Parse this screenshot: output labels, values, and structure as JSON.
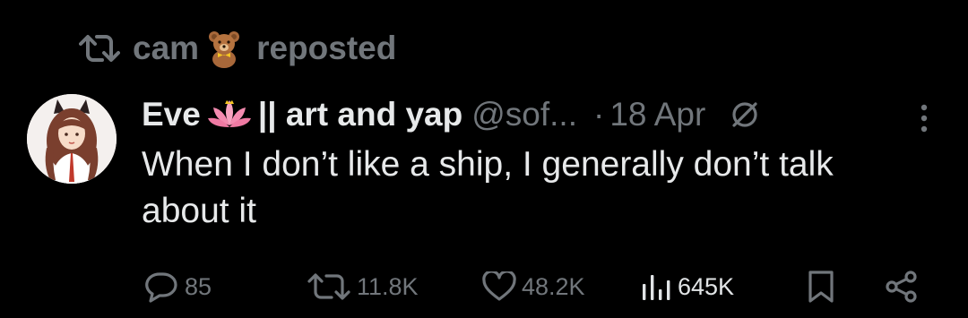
{
  "repost_banner": {
    "user": "cam",
    "user_emoji": "teddy-bear-emoji",
    "label": "reposted"
  },
  "tweet": {
    "author_name": "Eve",
    "author_emoji": "lotus-emoji",
    "author_suffix": "|| art and yap",
    "handle": "@sof...",
    "separator": "·",
    "date": "18 Apr",
    "text": "When I don’t like a ship, I generally don’t talk about it"
  },
  "actions": {
    "replies": "85",
    "reposts": "11.8K",
    "likes": "48.2K",
    "views": "645K"
  },
  "colors": {
    "background": "#000000",
    "primary_text": "#e7e9ea",
    "secondary_text": "#71767b"
  }
}
